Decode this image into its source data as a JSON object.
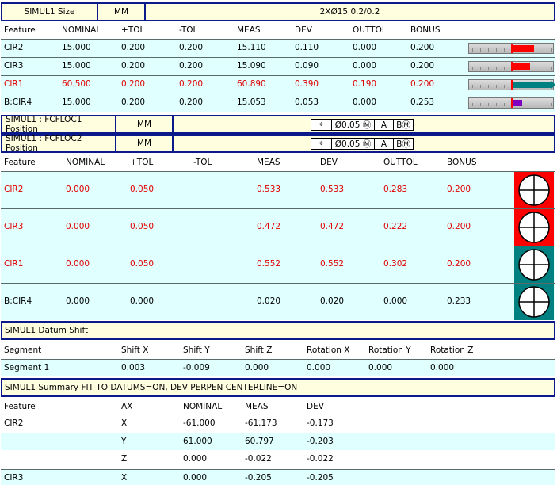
{
  "size_header": {
    "name": "SIMUL1 Size",
    "units": "MM",
    "callout": "2XØ15  0.2/0.2"
  },
  "size_cols": [
    "Feature",
    "NOMINAL",
    "+TOL",
    "-TOL",
    "MEAS",
    "DEV",
    "OUTTOL",
    "BONUS"
  ],
  "size_rows": [
    {
      "feature": "CIR2",
      "nominal": "15.000",
      "ptol": "0.200",
      "mtol": "0.200",
      "meas": "15.110",
      "dev": "0.110",
      "outtol": "0.000",
      "bonus": "0.200",
      "out": false,
      "bar_level": 0.55,
      "bar_color": "#ff0000"
    },
    {
      "feature": "CIR3",
      "nominal": "15.000",
      "ptol": "0.200",
      "mtol": "0.200",
      "meas": "15.090",
      "dev": "0.090",
      "outtol": "0.000",
      "bonus": "0.200",
      "out": false,
      "bar_level": 0.45,
      "bar_color": "#ff0000"
    },
    {
      "feature": "CIR1",
      "nominal": "60.500",
      "ptol": "0.200",
      "mtol": "0.200",
      "meas": "60.890",
      "dev": "0.390",
      "outtol": "0.190",
      "bonus": "0.200",
      "out": true,
      "bar_level": 1.0,
      "bar_color": "#008080"
    },
    {
      "feature": "B:CIR4",
      "nominal": "15.000",
      "ptol": "0.200",
      "mtol": "0.200",
      "meas": "15.053",
      "dev": "0.053",
      "outtol": "0.000",
      "bonus": "0.253",
      "out": false,
      "bar_level": 0.26,
      "bar_color": "#8000c0"
    }
  ],
  "pos_headers": [
    {
      "name": "SIMUL1 : FCFLOC1 Position",
      "units": "MM",
      "fcf": [
        "⌖",
        "Ø0.05 Ⓜ",
        "A",
        "BⓂ"
      ]
    },
    {
      "name": "SIMUL1 : FCFLOC2 Position",
      "units": "MM",
      "fcf": [
        "⌖",
        "Ø0.05 Ⓜ",
        "A",
        "BⓂ"
      ]
    }
  ],
  "pos_cols": [
    "Feature",
    "NOMINAL",
    "+TOL",
    "-TOL",
    "MEAS",
    "DEV",
    "OUTTOL",
    "BONUS"
  ],
  "pos_rows": [
    {
      "feature": "CIR2",
      "nominal": "0.000",
      "ptol": "0.050",
      "meas": "0.533",
      "dev": "0.533",
      "outtol": "0.283",
      "bonus": "0.200",
      "out": true,
      "tgt_bg": "#ff0000"
    },
    {
      "feature": "CIR3",
      "nominal": "0.000",
      "ptol": "0.050",
      "meas": "0.472",
      "dev": "0.472",
      "outtol": "0.222",
      "bonus": "0.200",
      "out": true,
      "tgt_bg": "#ff0000"
    },
    {
      "feature": "CIR1",
      "nominal": "0.000",
      "ptol": "0.050",
      "meas": "0.552",
      "dev": "0.552",
      "outtol": "0.302",
      "bonus": "0.200",
      "out": true,
      "tgt_bg": "#008080"
    },
    {
      "feature": "B:CIR4",
      "nominal": "0.000",
      "ptol": "0.000",
      "meas": "0.020",
      "dev": "0.020",
      "outtol": "0.000",
      "bonus": "0.233",
      "out": false,
      "tgt_bg": "#008080"
    }
  ],
  "datum_header": "SIMUL1 Datum Shift",
  "datum_cols": [
    "Segment",
    "Shift X",
    "Shift Y",
    "Shift Z",
    "Rotation X",
    "Rotation Y",
    "Rotation Z"
  ],
  "datum_rows": [
    {
      "segment": "Segment 1",
      "sx": "0.003",
      "sy": "-0.009",
      "sz": "0.000",
      "rx": "0.000",
      "ry": "0.000",
      "rz": "0.000"
    }
  ],
  "summary_header": "SIMUL1 Summary  FIT TO DATUMS=ON,  DEV PERPEN CENTERLINE=ON",
  "summary_cols": [
    "Feature",
    "AX",
    "NOMINAL",
    "MEAS",
    "DEV"
  ],
  "summary_rows": [
    {
      "feature": "CIR2",
      "ax": "X",
      "nominal": "-61.000",
      "meas": "-61.173",
      "dev": "-0.173",
      "bg": "white"
    },
    {
      "feature": "",
      "ax": "Y",
      "nominal": "61.000",
      "meas": "60.797",
      "dev": "-0.203",
      "bg": "cyan"
    },
    {
      "feature": "",
      "ax": "Z",
      "nominal": "0.000",
      "meas": "-0.022",
      "dev": "-0.022",
      "bg": "white"
    },
    {
      "feature": "CIR3",
      "ax": "X",
      "nominal": "0.000",
      "meas": "-0.205",
      "dev": "-0.205",
      "bg": "cyan"
    }
  ]
}
